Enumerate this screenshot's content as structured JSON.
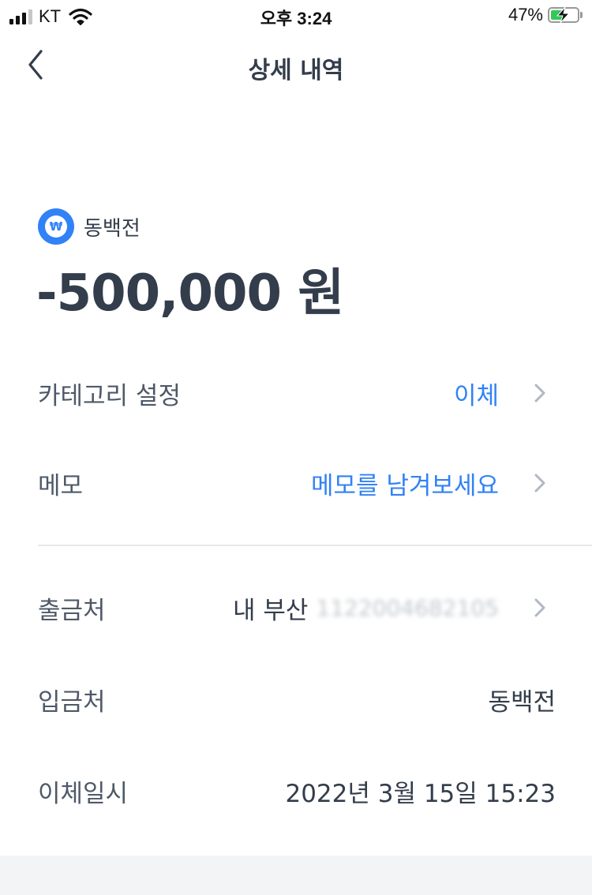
{
  "status_bar": {
    "carrier": "KT",
    "time": "오후 3:24",
    "battery_percent": "47%",
    "battery_level": 0.47,
    "charging": true,
    "signal_bars": 3,
    "icons": [
      "signal-icon",
      "wifi-icon",
      "battery-icon",
      "charging-bolt-icon"
    ]
  },
  "nav": {
    "title": "상세 내역",
    "back_icon": "chevron-left-icon"
  },
  "account": {
    "icon": "won-coin-icon",
    "icon_glyph": "₩",
    "name": "동백전",
    "amount": "-500,000 원"
  },
  "details": {
    "category": {
      "label": "카테고리 설정",
      "value": "이체"
    },
    "memo": {
      "label": "메모",
      "value": "메모를 남겨보세요"
    },
    "withdraw_from": {
      "label": "출금처",
      "value_prefix": "내 부산",
      "value_blurred": "1122004682105"
    },
    "deposit_to": {
      "label": "입금처",
      "value": "동백전"
    },
    "transfer_datetime": {
      "label": "이체일시",
      "value": "2022년 3월 15일 15:23"
    }
  },
  "colors": {
    "accent": "#3182f6",
    "text_primary": "#333d4b",
    "text_secondary": "#4e5968",
    "chevron": "#b0b8c1",
    "divider": "#e5e8eb",
    "footer_band": "#f2f4f6",
    "battery_green": "#34c759"
  }
}
